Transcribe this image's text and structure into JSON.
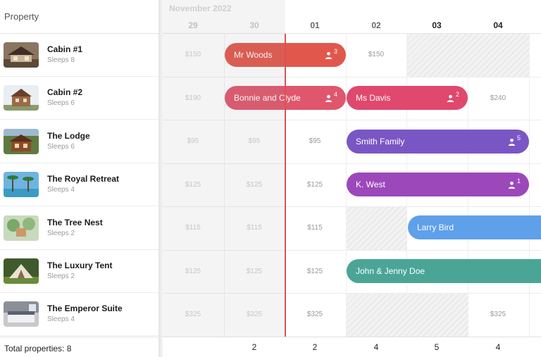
{
  "header": {
    "property_column_title": "Property",
    "month_label": "November 2022",
    "days": [
      {
        "label": "29",
        "state": "past"
      },
      {
        "label": "30",
        "state": "past"
      },
      {
        "label": "01",
        "state": "current"
      },
      {
        "label": "02",
        "state": "current"
      },
      {
        "label": "03",
        "state": "highlight"
      },
      {
        "label": "04",
        "state": "highlight"
      }
    ]
  },
  "properties": [
    {
      "name": "Cabin #1",
      "sleeps": "Sleeps 8",
      "thumb_icon": "cabin-photo-thumbnail"
    },
    {
      "name": "Cabin #2",
      "sleeps": "Sleeps 6",
      "thumb_icon": "cabin-photo-thumbnail"
    },
    {
      "name": "The Lodge",
      "sleeps": "Sleeps 6",
      "thumb_icon": "lodge-photo-thumbnail"
    },
    {
      "name": "The Royal Retreat",
      "sleeps": "Sleeps 4",
      "thumb_icon": "beach-villa-photo-thumbnail"
    },
    {
      "name": "The Tree Nest",
      "sleeps": "Sleeps 2",
      "thumb_icon": "treehouse-photo-thumbnail"
    },
    {
      "name": "The Luxury Tent",
      "sleeps": "Sleeps 2",
      "thumb_icon": "tent-photo-thumbnail"
    },
    {
      "name": "The Emperor Suite",
      "sleeps": "Sleeps 4",
      "thumb_icon": "suite-photo-thumbnail"
    }
  ],
  "prices": [
    [
      "$150",
      "",
      "",
      "$150",
      "",
      ""
    ],
    [
      "$190",
      "",
      "",
      "",
      "",
      "$240"
    ],
    [
      "$95",
      "$95",
      "$95",
      "",
      "",
      ""
    ],
    [
      "$125",
      "$125",
      "$125",
      "",
      "",
      ""
    ],
    [
      "$115",
      "$115",
      "$115",
      "",
      "",
      ""
    ],
    [
      "$125",
      "$125",
      "$125",
      "",
      "",
      ""
    ],
    [
      "$325",
      "$325",
      "$325",
      "",
      "",
      "$325"
    ]
  ],
  "bookings": [
    {
      "guest": "Mr Woods",
      "guests": "3",
      "color": "#e2574c"
    },
    {
      "guest": "Bonnie and Clyde",
      "guests": "4",
      "color": "#e0566c"
    },
    {
      "guest": "Ms Davis",
      "guests": "2",
      "color": "#e0486e"
    },
    {
      "guest": "Smith Family",
      "guests": "5",
      "color": "#7a56c5"
    },
    {
      "guest": "K. West",
      "guests": "1",
      "color": "#9c48bb"
    },
    {
      "guest": "Larry Bird",
      "guests": "",
      "color": "#5ea0ea"
    },
    {
      "guest": "John & Jenny Doe",
      "guests": "",
      "color": "#4aa597"
    }
  ],
  "footer": {
    "total_label": "Total properties: 8",
    "counts": [
      "",
      "2",
      "2",
      "4",
      "5",
      "4"
    ]
  },
  "colors": {
    "now_indicator": "#d9534f",
    "blocked_pattern": "#e2e2e2"
  }
}
